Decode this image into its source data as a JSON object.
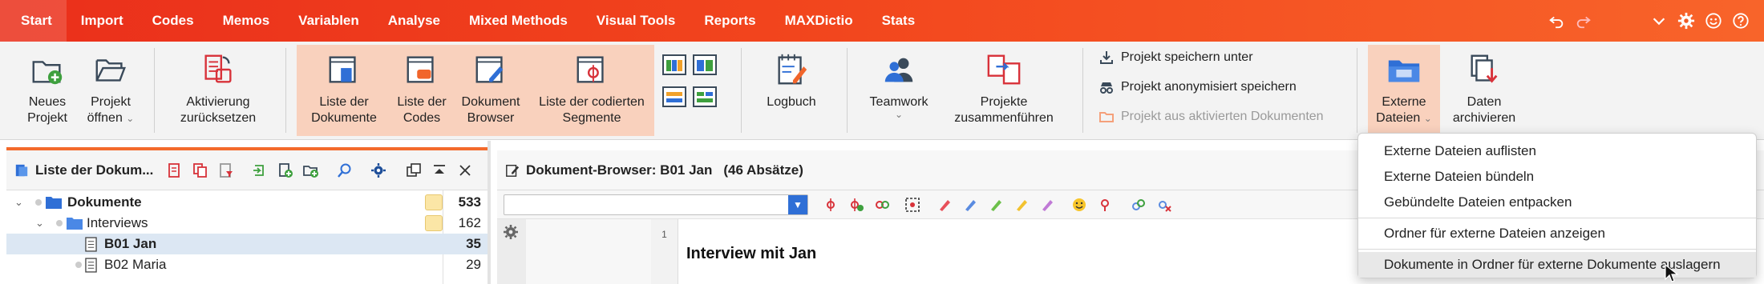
{
  "menubar": {
    "items": [
      "Start",
      "Import",
      "Codes",
      "Memos",
      "Variablen",
      "Analyse",
      "Mixed Methods",
      "Visual Tools",
      "Reports",
      "MAXDictio",
      "Stats"
    ],
    "active": "Start",
    "right_icons": [
      "undo-icon",
      "redo-icon",
      "chevron-down-icon",
      "gear-icon",
      "smiley-icon",
      "help-icon"
    ]
  },
  "ribbon": {
    "neues_projekt": [
      "Neues",
      "Projekt"
    ],
    "projekt_oeffnen": [
      "Projekt",
      "öffnen"
    ],
    "aktivierung": [
      "Aktivierung",
      "zurücksetzen"
    ],
    "liste_dokumente": [
      "Liste der",
      "Dokumente"
    ],
    "liste_codes": [
      "Liste der",
      "Codes"
    ],
    "dokument_browser": [
      "Dokument",
      "Browser"
    ],
    "liste_segmente": [
      "Liste der codierten",
      "Segmente"
    ],
    "logbuch": "Logbuch",
    "teamwork": "Teamwork",
    "projekte_zusammen": [
      "Projekte",
      "zusammenführen"
    ],
    "speichern_unter": "Projekt speichern unter",
    "anonymisiert": "Projekt anonymisiert speichern",
    "aus_aktivierten": "Projekt aus aktivierten Dokumenten",
    "externe_dateien": [
      "Externe",
      "Dateien"
    ],
    "daten_archivieren": [
      "Daten",
      "archivieren"
    ]
  },
  "left_panel": {
    "title": "Liste der Dokum...",
    "rows": [
      {
        "label": "Dokumente",
        "count": "533"
      },
      {
        "label": "Interviews",
        "count": "162"
      },
      {
        "label": "B01 Jan",
        "count": "35"
      },
      {
        "label": "B02 Maria",
        "count": "29"
      }
    ]
  },
  "doc_browser": {
    "title": "Dokument-Browser: B01 Jan",
    "paragraphs": "(46 Absätze)",
    "line_number": "1",
    "text": "Interview mit Jan"
  },
  "dropdown": {
    "items": [
      "Externe Dateien auflisten",
      "Externe Dateien bündeln",
      "Gebündelte Dateien entpacken",
      "Ordner für externe Dateien anzeigen",
      "Dokumente in Ordner für externe Dokumente auslagern"
    ]
  },
  "colors": {
    "menubar_start": "#ea2f1b",
    "menubar_end": "#f8642a",
    "ribbon_highlight": "#f9d1bd",
    "selection": "#dce7f3",
    "accent_blue": "#2f6fd6"
  }
}
